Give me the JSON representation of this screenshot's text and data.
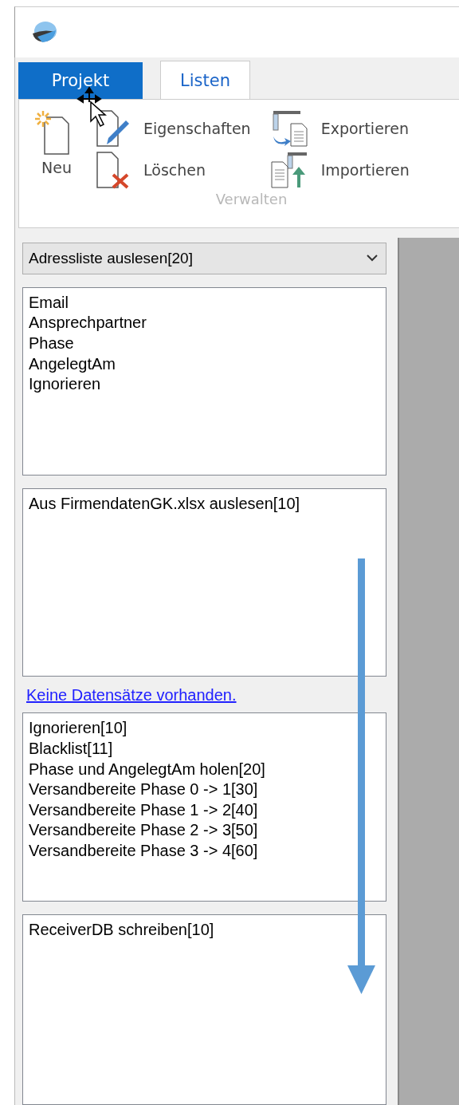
{
  "tabs": [
    {
      "label": "Projekt",
      "kind": "file",
      "selected": false
    },
    {
      "label": "Listen",
      "kind": "tab",
      "selected": true
    }
  ],
  "ribbon": {
    "new_button": "Neu",
    "small_buttons": [
      {
        "label": "Eigenschaften",
        "kind": "edit"
      },
      {
        "label": "Löschen",
        "kind": "delete"
      },
      {
        "label": "Exportieren",
        "kind": "export"
      },
      {
        "label": "Importieren",
        "kind": "import"
      }
    ],
    "group_label": "Verwalten"
  },
  "dropdown": {
    "value": "Adressliste auslesen[20]"
  },
  "lists": [
    {
      "items": [
        "Email",
        "Ansprechpartner",
        "Phase",
        "AngelegtAm",
        "Ignorieren"
      ]
    },
    {
      "items": [
        "Aus FirmendatenGK.xlsx auslesen[10]"
      ]
    },
    {
      "link": "Keine Datensätze vorhanden.",
      "items": [
        "Ignorieren[10]",
        "Blacklist[11]",
        "Phase und AngelegtAm holen[20]",
        "Versandbereite Phase 0 -> 1[30]",
        "Versandbereite Phase 1 -> 2[40]",
        "Versandbereite Phase 2 -> 3[50]",
        "Versandbereite Phase 3 -> 4[60]"
      ]
    },
    {
      "items": [
        "ReceiverDB schreiben[10]"
      ]
    }
  ]
}
